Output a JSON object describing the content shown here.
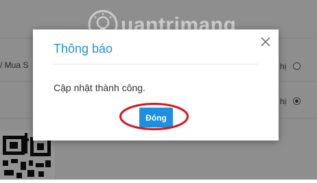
{
  "background": {
    "row_text_left": "/ Mua S",
    "row_text_right_1": "hị",
    "row_text_right_2": "hị"
  },
  "watermark": {
    "text": "uantrimang",
    "icon": "lightbulb-logo"
  },
  "dialog": {
    "title": "Thông báo",
    "message": "Cập nhật thành công.",
    "ok_label": "Đóng",
    "close_icon": "close-icon"
  },
  "colors": {
    "title": "#2a8fd6",
    "button": "#1e8ee0",
    "highlight": "#d9141f"
  }
}
